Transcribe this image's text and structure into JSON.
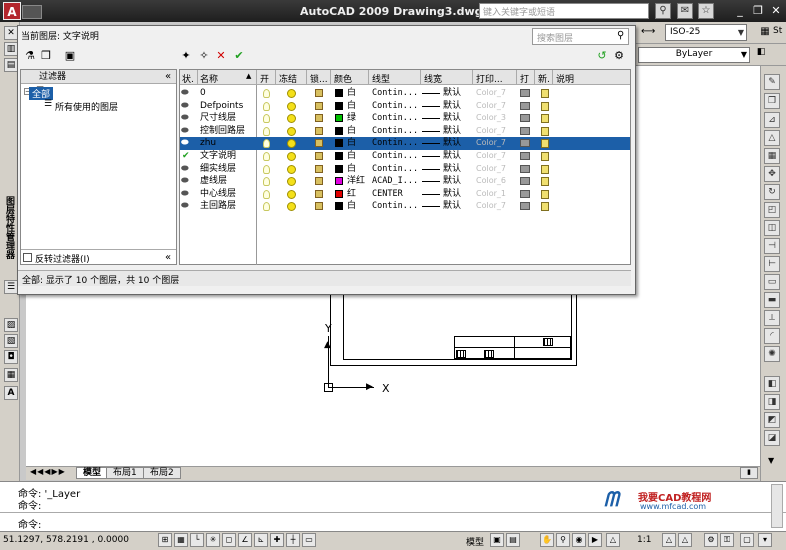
{
  "window": {
    "logo": "A",
    "title": "AutoCAD 2009 Drawing3.dwg",
    "help_search_placeholder": "键入关键字或短语"
  },
  "toolbars": {
    "dimstyle_value": "ISO-25",
    "right_edge_text": "St",
    "lineweight_value": "ByLayer"
  },
  "palette_label": "图层特性管理器",
  "dialog": {
    "current_layer_label": "当前图层: 文字说明",
    "search_placeholder": "搜索图层",
    "filter_header": "过滤器",
    "filter_tree": {
      "all": "全部",
      "used": "所有使用的图层"
    },
    "invert_filter_label": "反转过滤器(I)",
    "collapse_glyph": "«",
    "columns": [
      "状.",
      "名称",
      "开",
      "冻结",
      "锁...",
      "颜色",
      "线型",
      "线宽",
      "打印...",
      "打",
      "新.",
      "说明"
    ],
    "layers": [
      {
        "state": "",
        "name": "0",
        "color_hex": "#000000",
        "color_name": "白",
        "linetype": "Contin...",
        "lineweight": "默认",
        "plot_style": "Color_7"
      },
      {
        "state": "",
        "name": "Defpoints",
        "color_hex": "#000000",
        "color_name": "白",
        "linetype": "Contin...",
        "lineweight": "默认",
        "plot_style": "Color_7"
      },
      {
        "state": "",
        "name": "尺寸线层",
        "color_hex": "#00c000",
        "color_name": "绿",
        "linetype": "Contin...",
        "lineweight": "默认",
        "plot_style": "Color_3"
      },
      {
        "state": "",
        "name": "控制回路层",
        "color_hex": "#000000",
        "color_name": "白",
        "linetype": "Contin...",
        "lineweight": "默认",
        "plot_style": "Color_7"
      },
      {
        "state": "",
        "name": "zhu",
        "color_hex": "#000000",
        "color_name": "白",
        "linetype": "Contin...",
        "lineweight": "默认",
        "plot_style": "Color_7",
        "selected": true
      },
      {
        "state": "current",
        "name": "文字说明",
        "color_hex": "#000000",
        "color_name": "白",
        "linetype": "Contin...",
        "lineweight": "默认",
        "plot_style": "Color_7"
      },
      {
        "state": "",
        "name": "细实线层",
        "color_hex": "#000000",
        "color_name": "白",
        "linetype": "Contin...",
        "lineweight": "默认",
        "plot_style": "Color_7"
      },
      {
        "state": "",
        "name": "虚线层",
        "color_hex": "#e000e0",
        "color_name": "洋红",
        "linetype": "ACAD_I...",
        "lineweight": "默认",
        "plot_style": "Color_6"
      },
      {
        "state": "",
        "name": "中心线层",
        "color_hex": "#e00000",
        "color_name": "红",
        "linetype": "CENTER",
        "lineweight": "默认",
        "plot_style": "Color_1"
      },
      {
        "state": "",
        "name": "主回路层",
        "color_hex": "#000000",
        "color_name": "白",
        "linetype": "Contin...",
        "lineweight": "默认",
        "plot_style": "Color_7"
      }
    ],
    "status": "全部: 显示了 10 个图层，共 10 个图层"
  },
  "drawing": {
    "ucs_y": "Y",
    "ucs_x": "X"
  },
  "tabs": [
    "模型",
    "布局1",
    "布局2"
  ],
  "command": {
    "lines": [
      "命令: '_Layer",
      "命令:",
      "命令:"
    ]
  },
  "watermark": {
    "name": "我要CAD教程网",
    "url": "www.mfcad.com"
  },
  "status_bar": {
    "coords": "51.1297, 578.2191 , 0.0000",
    "model": "模型",
    "scale": "1:1"
  }
}
